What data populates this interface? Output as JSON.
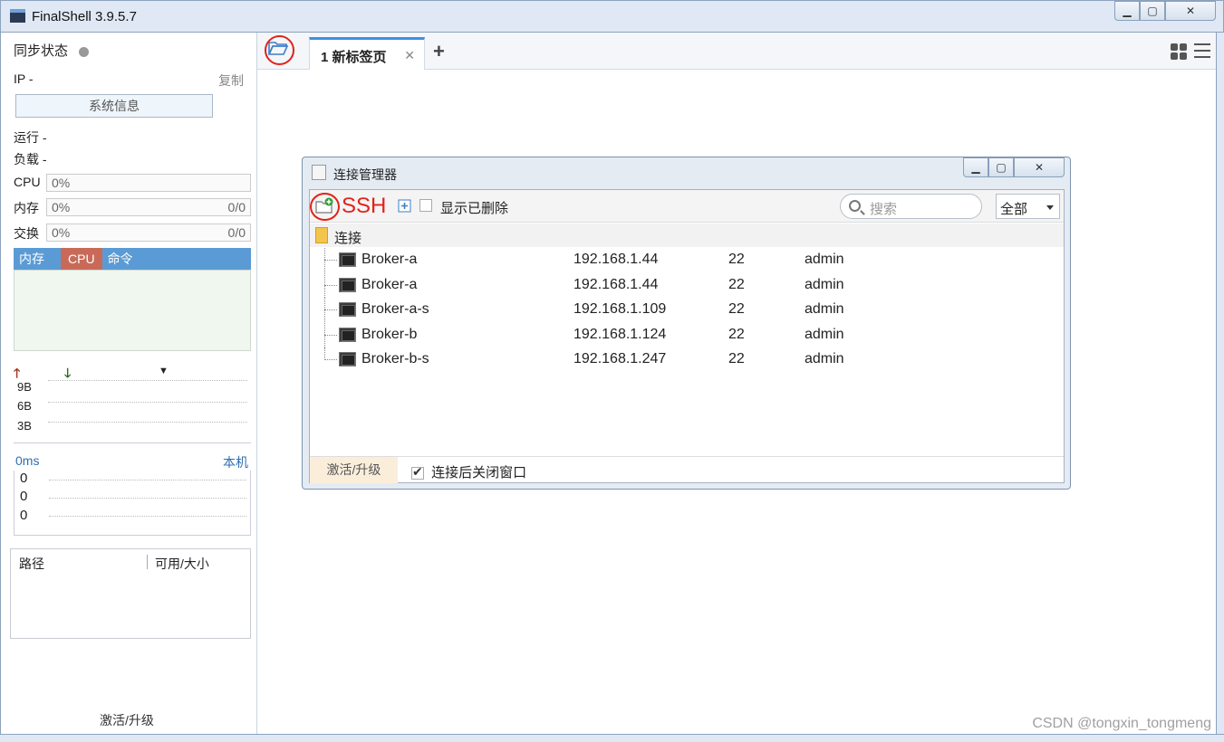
{
  "window": {
    "title": "FinalShell 3.9.5.7"
  },
  "sidebar": {
    "sync_label": "同步状态",
    "ip_label": "IP -",
    "copy_label": "复制",
    "sysinfo_label": "系统信息",
    "run_label": "运行 -",
    "load_label": "负载 -",
    "cpu": {
      "label": "CPU",
      "value": "0%"
    },
    "mem": {
      "label": "内存",
      "value": "0%",
      "ratio": "0/0"
    },
    "swap": {
      "label": "交换",
      "value": "0%",
      "ratio": "0/0"
    },
    "proc_tabs": [
      "内存",
      "CPU",
      "命令"
    ],
    "net_scale": [
      "9B",
      "6B",
      "3B"
    ],
    "ping": {
      "value": "0ms",
      "target": "本机",
      "rows": [
        "0",
        "0",
        "0"
      ]
    },
    "fs_headers": [
      "路径",
      "可用/大小"
    ],
    "activate_label": "激活/升级"
  },
  "tabs": [
    {
      "label": "1 新标签页"
    }
  ],
  "dialog": {
    "title": "连接管理器",
    "toolbar": {
      "ssh_annotation": "SSH",
      "show_deleted_label": "显示已删除",
      "search_placeholder": "搜索",
      "filter_value": "全部"
    },
    "group_label": "连接",
    "connections": [
      {
        "name": "Broker-a",
        "ip": "192.168.1.44",
        "port": "22",
        "user": "admin"
      },
      {
        "name": "Broker-a",
        "ip": "192.168.1.44",
        "port": "22",
        "user": "admin"
      },
      {
        "name": "Broker-a-s",
        "ip": "192.168.1.109",
        "port": "22",
        "user": "admin"
      },
      {
        "name": "Broker-b",
        "ip": "192.168.1.124",
        "port": "22",
        "user": "admin"
      },
      {
        "name": "Broker-b-s",
        "ip": "192.168.1.247",
        "port": "22",
        "user": "admin"
      }
    ],
    "footer": {
      "activate_label": "激活/升级",
      "close_after_connect_label": "连接后关闭窗口"
    }
  },
  "watermark": "CSDN @tongxin_tongmeng",
  "colors": {
    "accent": "#3e8ee6",
    "annotation": "#e0231b",
    "proc_tab_bg": "#5b9bd5",
    "proc_tab_active": "#c96a58"
  }
}
